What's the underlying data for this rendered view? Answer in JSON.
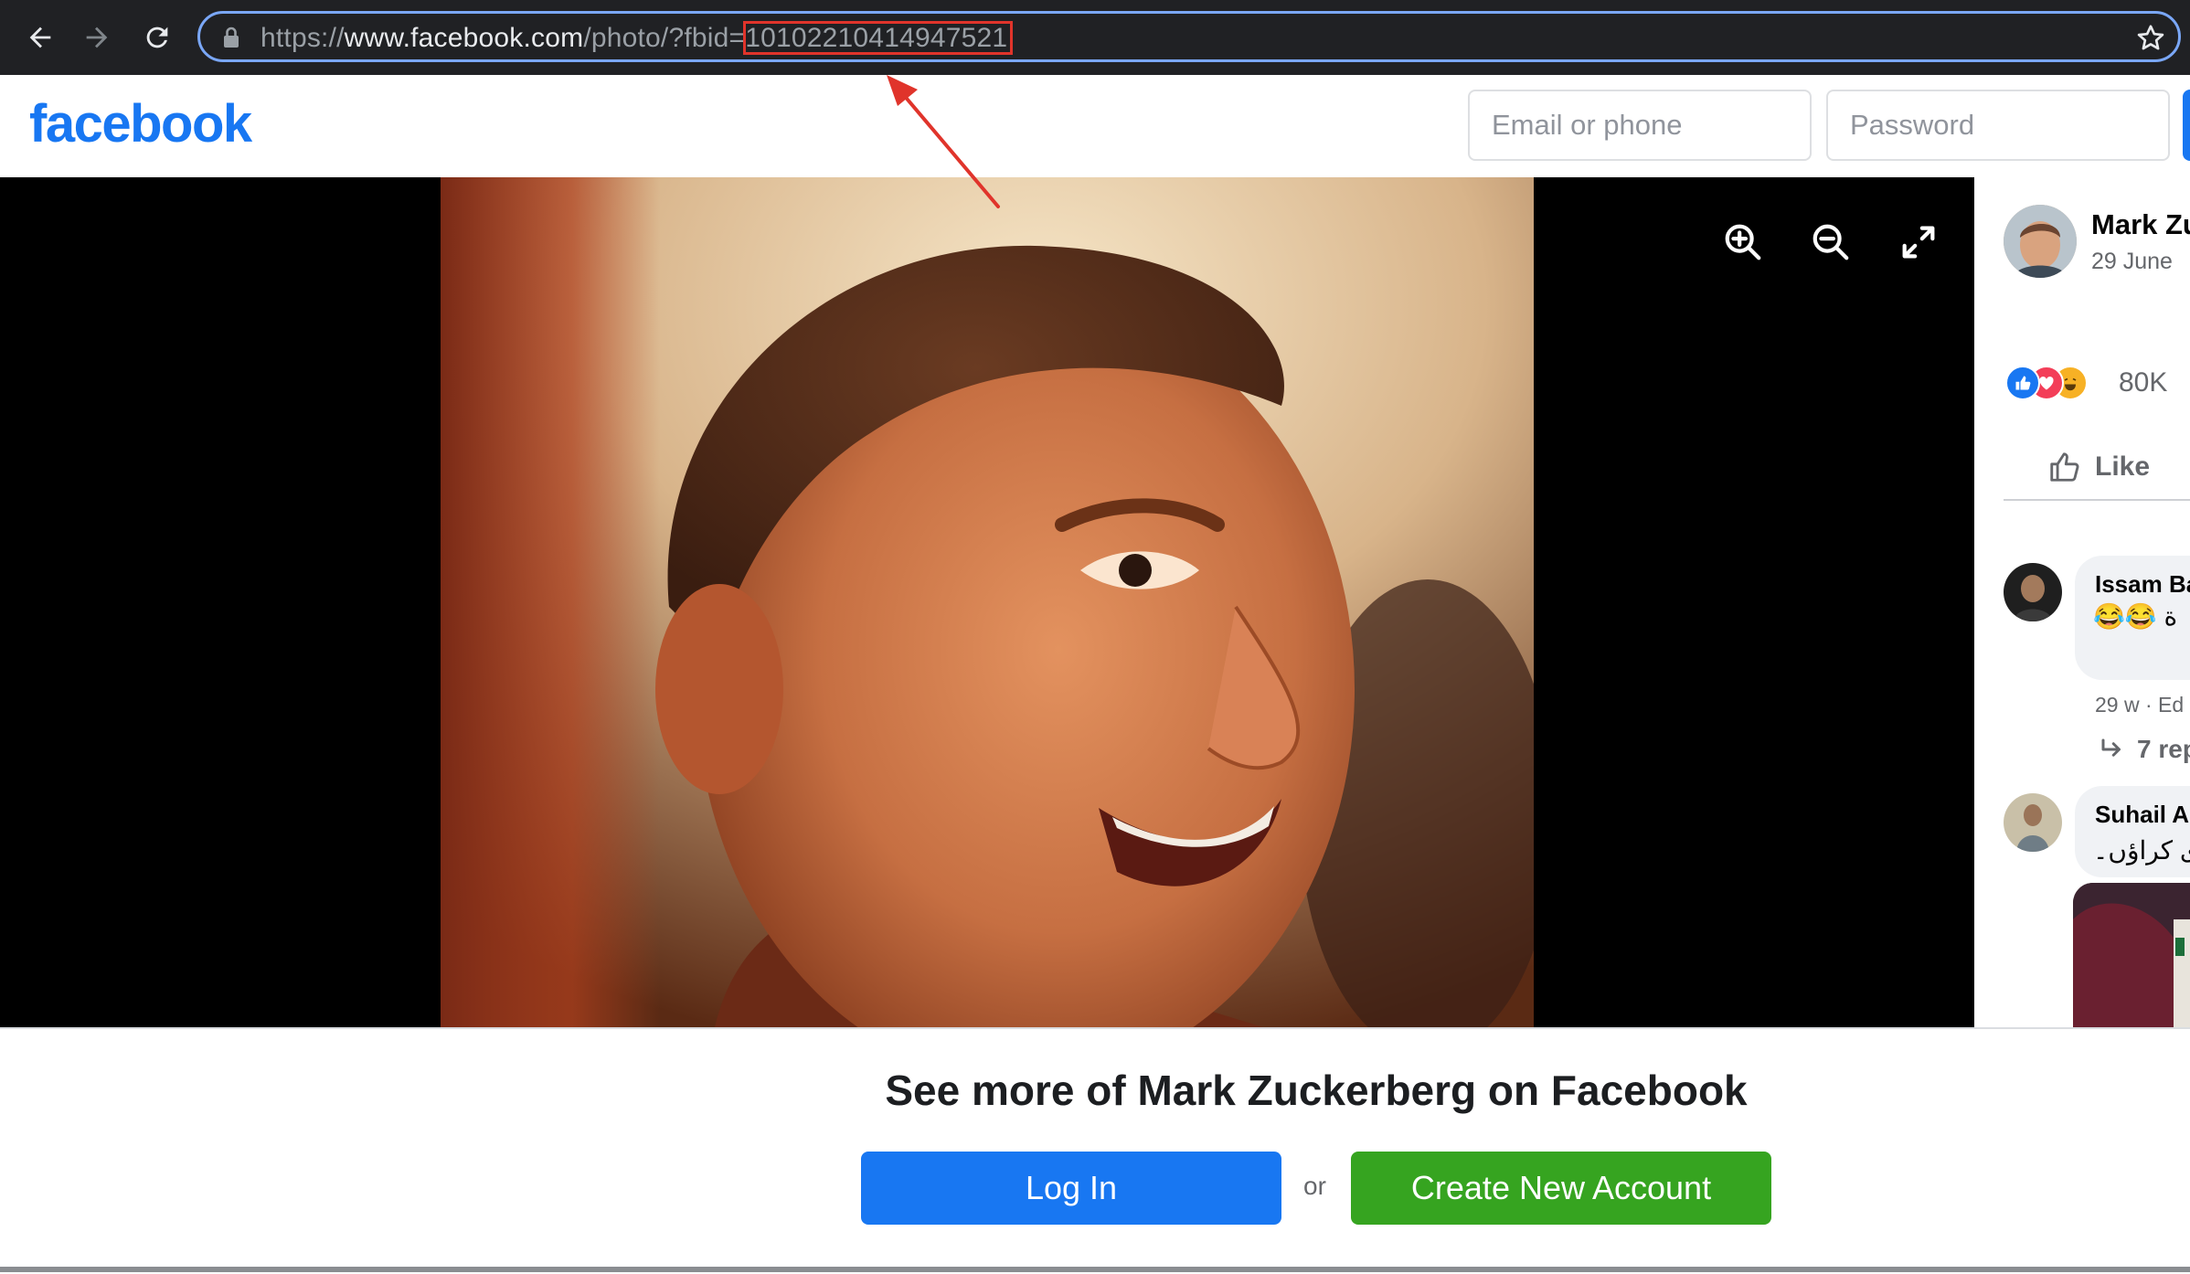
{
  "browser": {
    "back_icon": "arrow-left-icon",
    "forward_icon": "arrow-right-icon",
    "reload_icon": "reload-icon",
    "url_scheme": "https://",
    "url_host": "www.facebook.com",
    "url_path": "/photo/?fbid=",
    "url_fbid": "10102210414947521",
    "lock_icon": "lock-icon",
    "bookmark_icon": "star-icon"
  },
  "header": {
    "logo": "facebook",
    "email_placeholder": "Email or phone",
    "password_placeholder": "Password"
  },
  "viewer": {
    "zoom_in_icon": "zoom-in-icon",
    "zoom_out_icon": "zoom-out-icon",
    "fullscreen_icon": "expand-icon"
  },
  "post": {
    "author": "Mark Zu",
    "date": "29 June",
    "reaction_icons": [
      "like-reaction-icon",
      "love-reaction-icon",
      "haha-reaction-icon"
    ],
    "reaction_count": "80K",
    "like_label": "Like"
  },
  "comments": [
    {
      "author": "Issam Ba",
      "text": "😂😂 ة",
      "meta": "29 w · Ed",
      "replies": "7 rep"
    },
    {
      "author": "Suhail A",
      "text": "ی کراؤں۔"
    }
  ],
  "prompt": {
    "title": "See more of Mark Zuckerberg on Facebook",
    "login_label": "Log In",
    "or_label": "or",
    "create_label": "Create New Account"
  },
  "colors": {
    "fb_blue": "#1877f2",
    "fb_green": "#36a420",
    "annotation_red": "#e0342b",
    "chrome_dark": "#202124"
  }
}
